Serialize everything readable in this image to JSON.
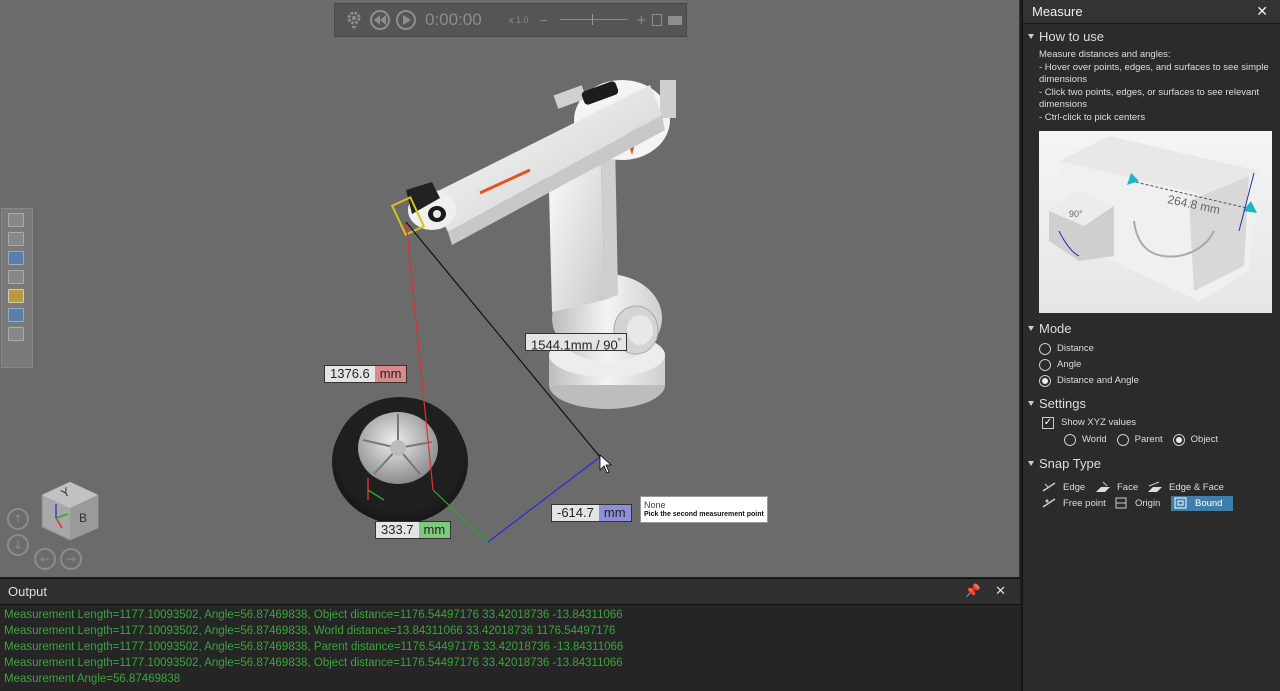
{
  "playback": {
    "time": "0:00:00",
    "speed": "x 1.0",
    "icons": [
      "gear-icon",
      "rewind-icon",
      "play-icon",
      "zoom-out-icon",
      "zoom-in-icon",
      "export-pdf-icon",
      "record-video-icon"
    ]
  },
  "viewport": {
    "measurements": {
      "main": {
        "value": "1544.1mm / 90",
        "suffix": "°"
      },
      "x": {
        "value": "1376.6",
        "unit": "mm",
        "color": "#d98a8a"
      },
      "y": {
        "value": "333.7",
        "unit": "mm",
        "color": "#7fc97f"
      },
      "z": {
        "value": "-614.7",
        "unit": "mm",
        "color": "#8f8fd8"
      }
    },
    "tooltip": {
      "title": "None",
      "hint": "Pick the second measurement point"
    },
    "navcube": {
      "face_top": "Y",
      "face_right": "B"
    }
  },
  "output": {
    "title": "Output",
    "lines": [
      "Measurement Length=1177.10093502, Angle=56.87469838, Object distance=1176.54497176 33.42018736 -13.84311066",
      "Measurement Length=1177.10093502, Angle=56.87469838, World distance=13.84311066 33.42018736 1176.54497176",
      "Measurement Length=1177.10093502, Angle=56.87469838, Parent distance=1176.54497176 33.42018736 -13.84311066",
      "Measurement Length=1177.10093502, Angle=56.87469838, Object distance=1176.54497176 33.42018736 -13.84311066",
      "Measurement Angle=56.87469838"
    ]
  },
  "panel": {
    "title": "Measure",
    "how_to_use": {
      "heading": "How to use",
      "intro": "Measure distances and angles:",
      "items": [
        " - Hover over points, edges, and surfaces to see simple dimensions",
        " - Click two points, edges, or surfaces to see relevant dimensions",
        " - Ctrl-click to pick centers"
      ],
      "preview_label": "264.8 mm",
      "preview_angle": "90°"
    },
    "mode": {
      "heading": "Mode",
      "options": [
        "Distance",
        "Angle",
        "Distance and Angle"
      ],
      "selected": "Distance and Angle"
    },
    "settings": {
      "heading": "Settings",
      "show_xyz": "Show XYZ values",
      "show_xyz_checked": true,
      "frames": [
        "World",
        "Parent",
        "Object"
      ],
      "selected_frame": "Object"
    },
    "snap": {
      "heading": "Snap Type",
      "types": [
        "Edge",
        "Face",
        "Edge & Face",
        "Free point",
        "Origin",
        "Bound"
      ],
      "active": "Bound"
    }
  }
}
